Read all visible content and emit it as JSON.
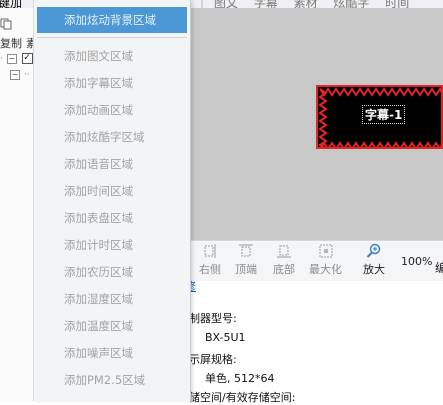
{
  "window": {
    "title_fragment": "键加"
  },
  "top_menu": [
    "图文",
    "字幕",
    "素材",
    "炫酷字",
    "时间"
  ],
  "left_panel": {
    "label_a": "复制",
    "label_b": "素"
  },
  "preview": {
    "caption": "字幕-1",
    "colors": {
      "screen_bg": "#000000",
      "border": "#e62424"
    }
  },
  "toolbar": {
    "buttons": [
      "右侧",
      "顶端",
      "底部",
      "最大化",
      "放大"
    ],
    "zoom": "100%",
    "extra_fragment": "编"
  },
  "info": {
    "link_fragment": "修",
    "controller_label": "制器型号:",
    "controller_value": "BX-5U1",
    "display_label": "示屏规格:",
    "display_value": "单色, 512*64",
    "storage_label": "储空间/有效存储空间:"
  },
  "dropdown": {
    "items": [
      "添加炫动背景区域",
      "添加图文区域",
      "添加字幕区域",
      "添加动画区域",
      "添加炫酷字区域",
      "添加语音区域",
      "添加时间区域",
      "添加表盘区域",
      "添加计时区域",
      "添加农历区域",
      "添加湿度区域",
      "添加温度区域",
      "添加噪声区域",
      "添加PM2.5区域"
    ],
    "highlight_color": "#4c98d7"
  }
}
